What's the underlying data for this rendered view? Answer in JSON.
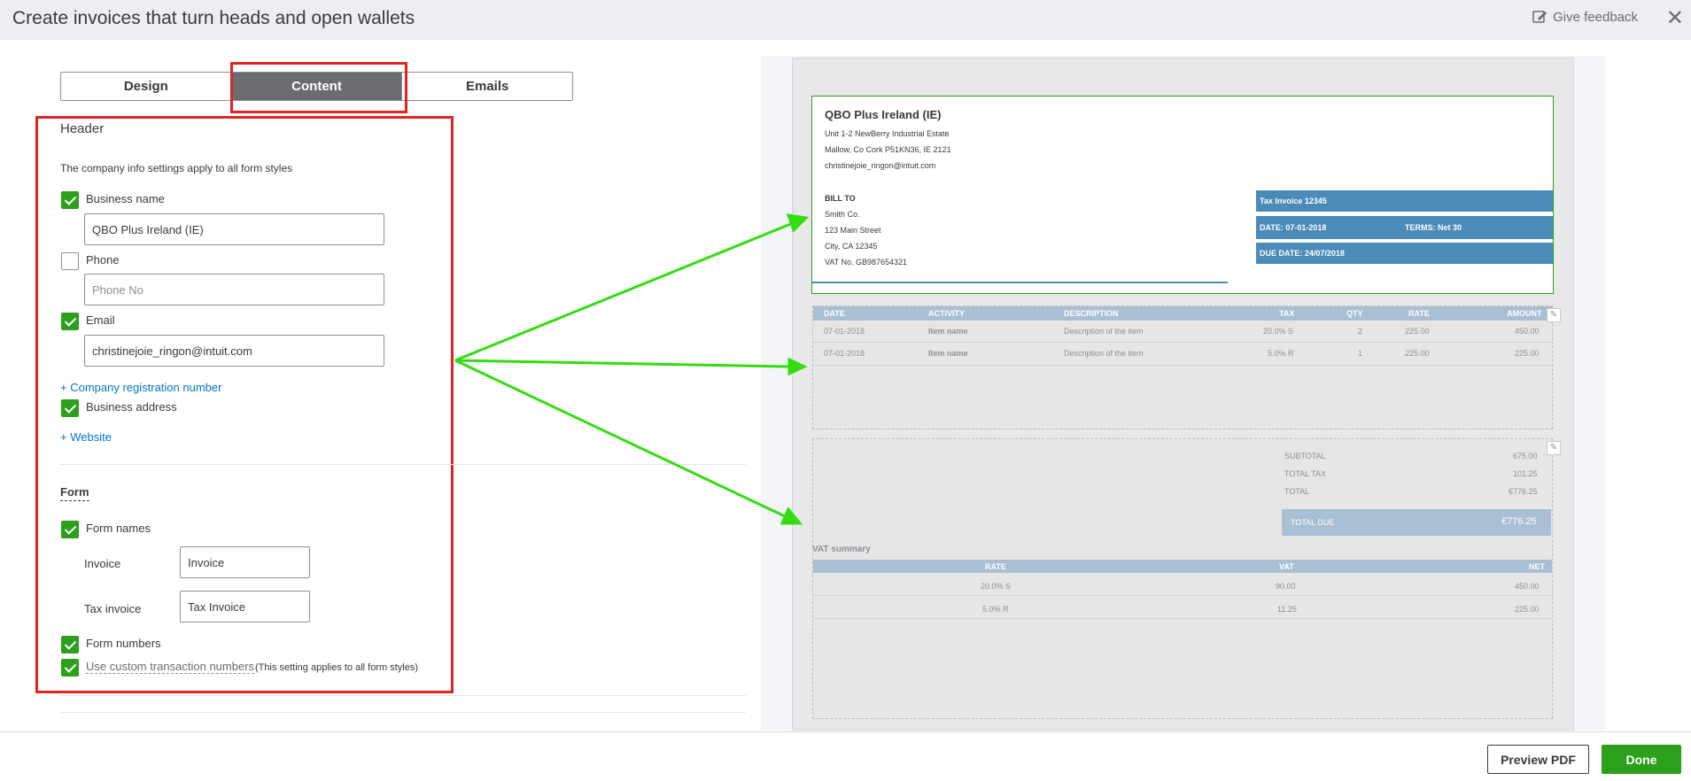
{
  "header": {
    "title": "Create invoices that turn heads and open wallets",
    "feedback": "Give feedback",
    "close": "✕"
  },
  "tabs": [
    {
      "label": "Design"
    },
    {
      "label": "Content"
    },
    {
      "label": "Emails"
    }
  ],
  "section_header": {
    "title": "Header",
    "note": "The company info settings apply to all form styles",
    "business_name": {
      "label": "Business name",
      "value": "QBO Plus Ireland (IE)"
    },
    "phone": {
      "label": "Phone",
      "placeholder": "Phone No"
    },
    "email": {
      "label": "Email",
      "value": "christinejoie_ringon@intuit.com"
    },
    "company_reg_link": "+ Company registration number",
    "business_address": {
      "label": "Business address"
    },
    "website_link": "+ Website"
  },
  "section_form": {
    "title": "Form",
    "form_names": {
      "label": "Form names"
    },
    "invoice": {
      "label": "Invoice",
      "value": "Invoice"
    },
    "tax_invoice": {
      "label": "Tax invoice",
      "value": "Tax Invoice"
    },
    "form_numbers": {
      "label": "Form numbers"
    },
    "custom_numbers": {
      "label": "Use custom transaction numbers",
      "note": "(This setting applies to all form styles)"
    }
  },
  "preview": {
    "company": "QBO Plus Ireland (IE)",
    "address1": "Unit 1-2 NewBerry Industrial Estate",
    "address2": "Mallow, Co Cork P51KN36, IE 2121",
    "email": "christinejoie_ringon@intuit.com",
    "bill_to_title": "BILL TO",
    "bill_to": [
      "Smith Co.",
      "123 Main Street",
      "City, CA 12345",
      "VAT No.  GB987654321"
    ],
    "tax_invoice": "Tax Invoice  12345",
    "date": "DATE:  07-01-2018",
    "terms": "TERMS: Net 30",
    "due_date": "DUE DATE: 24/07/2018",
    "columns": [
      "DATE",
      "ACTIVITY",
      "DESCRIPTION",
      "TAX",
      "QTY",
      "RATE",
      "AMOUNT"
    ],
    "rows": [
      [
        "07-01-2018",
        "Item name",
        "Description of the item",
        "20.0% S",
        "2",
        "225.00",
        "450.00"
      ],
      [
        "07-01-2018",
        "Item name",
        "Description of the item",
        "5.0% R",
        "1",
        "225.00",
        "225.00"
      ]
    ],
    "subtotal_label": "SUBTOTAL",
    "subtotal": "675.00",
    "total_tax_label": "TOTAL TAX",
    "total_tax": "101.25",
    "total_label": "TOTAL",
    "total": "€776.25",
    "total_due_label": "TOTAL DUE",
    "total_due": "€776.25",
    "vat_title": "VAT summary",
    "vat_columns": [
      "RATE",
      "VAT",
      "NET"
    ],
    "vat_rows": [
      [
        "20.0% S",
        "90.00",
        "450.00"
      ],
      [
        "5.0% R",
        "11.25",
        "225.00"
      ]
    ]
  },
  "footer": {
    "preview_pdf": "Preview PDF",
    "done": "Done"
  },
  "colors": {
    "accent_green": "#2ca01c",
    "annotation_red": "#e02424",
    "arrow_green": "#33dd11",
    "invoice_blue": "#4a8bb8"
  }
}
